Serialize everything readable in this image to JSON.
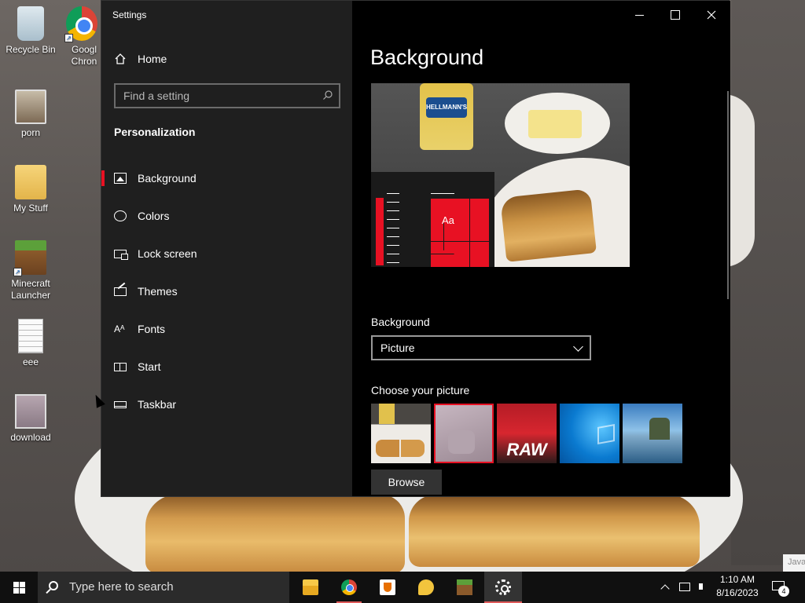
{
  "desktop": {
    "icons": [
      {
        "label": "Recycle Bin"
      },
      {
        "label": "Googl Chron"
      },
      {
        "label": "porn"
      },
      {
        "label": "My Stuff"
      },
      {
        "label": "Minecraft Launcher"
      },
      {
        "label": "eee"
      },
      {
        "label": "download"
      }
    ]
  },
  "window": {
    "title": "Settings"
  },
  "sidebar": {
    "home": "Home",
    "search_placeholder": "Find a setting",
    "section": "Personalization",
    "items": [
      {
        "label": "Background",
        "icon": "picture-icon",
        "active": true
      },
      {
        "label": "Colors",
        "icon": "palette-icon"
      },
      {
        "label": "Lock screen",
        "icon": "lock-screen-icon"
      },
      {
        "label": "Themes",
        "icon": "themes-icon"
      },
      {
        "label": "Fonts",
        "icon": "fonts-icon"
      },
      {
        "label": "Start",
        "icon": "start-icon"
      },
      {
        "label": "Taskbar",
        "icon": "taskbar-icon"
      }
    ]
  },
  "main": {
    "title": "Background",
    "preview": {
      "jar_label": "HELLMANN'S",
      "tile_text": "Aa"
    },
    "background_label": "Background",
    "background_value": "Picture",
    "choose_label": "Choose your picture",
    "thumbnails": [
      {
        "name": "grilled-cheese"
      },
      {
        "name": "cat",
        "selected": true
      },
      {
        "name": "raw",
        "text": "RAW"
      },
      {
        "name": "windows-blue"
      },
      {
        "name": "beach"
      }
    ],
    "browse_label": "Browse"
  },
  "taskbar": {
    "search_placeholder": "Type here to search",
    "time": "1:10 AM",
    "date": "8/16/2023",
    "notification_count": "4",
    "java_popup": "Java"
  },
  "colors": {
    "accent": "#e81123"
  }
}
